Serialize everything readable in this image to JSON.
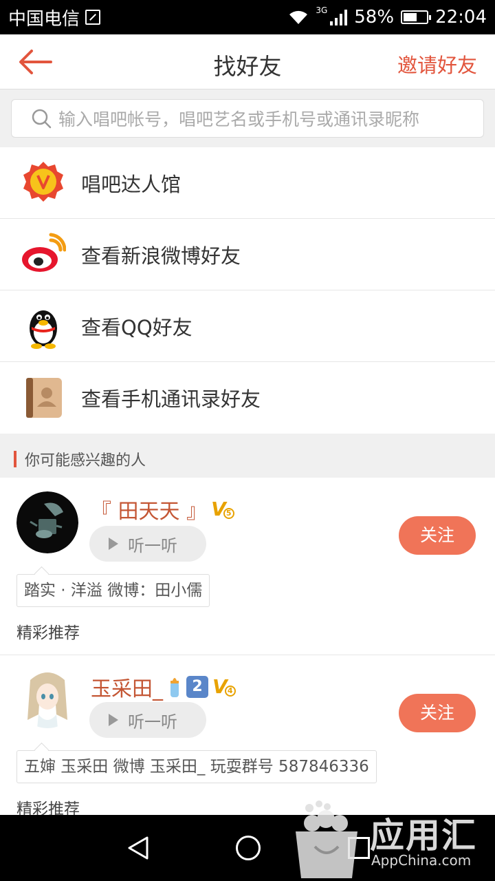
{
  "status_bar": {
    "carrier": "中国电信",
    "network": "3G",
    "battery": "58%",
    "battery_level": 0.58,
    "time": "22:04"
  },
  "header": {
    "title": "找好友",
    "invite_label": "邀请好友",
    "back_icon": "arrow-left-icon"
  },
  "search": {
    "placeholder": "输入唱吧帐号，唱吧艺名或手机号或通讯录昵称"
  },
  "menu": {
    "items": [
      {
        "label": "唱吧达人馆",
        "icon": "vip-badge-icon"
      },
      {
        "label": "查看新浪微博好友",
        "icon": "weibo-icon"
      },
      {
        "label": "查看QQ好友",
        "icon": "qq-penguin-icon"
      },
      {
        "label": "查看手机通讯录好友",
        "icon": "contacts-book-icon"
      }
    ]
  },
  "section": {
    "title": "你可能感兴趣的人"
  },
  "users": [
    {
      "name": "『 田天天 』",
      "vip_level": "5",
      "listen_label": "听一听",
      "follow_label": "关注",
      "intro": "踏实 · 洋溢 微博：田小儒",
      "recommend_label": "精彩推荐"
    },
    {
      "name": "玉采田_",
      "level_badge": "2",
      "vip_level": "4",
      "listen_label": "听一听",
      "follow_label": "关注",
      "intro": "五婶 玉采田 微博 玉采田_ 玩耍群号 587846336",
      "recommend_label": "精彩推荐"
    }
  ],
  "watermark": {
    "text": "应用汇",
    "sub": "AppChina.com"
  },
  "colors": {
    "accent": "#e2553d",
    "follow_button": "#f07458",
    "username": "#c45634"
  }
}
